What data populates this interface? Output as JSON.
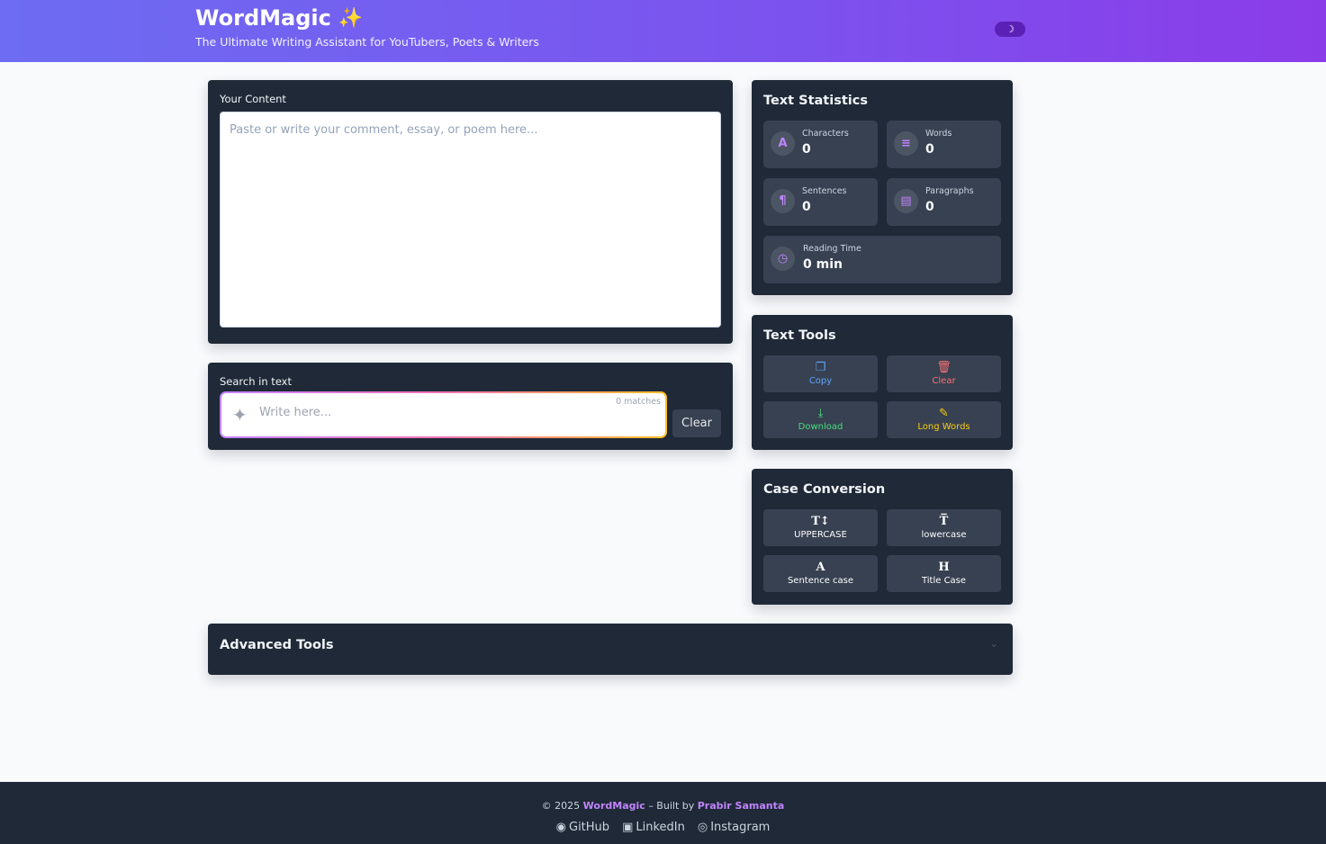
{
  "header": {
    "title": "WordMagic",
    "sparkle": "✨",
    "subtitle": "The Ultimate Writing Assistant for YouTubers, Poets & Writers",
    "theme_icon": "moon-icon"
  },
  "content": {
    "label": "Your Content",
    "placeholder": "Paste or write your comment, essay, or poem here..."
  },
  "search": {
    "label": "Search in text",
    "placeholder": "Write here...",
    "matches": "0 matches",
    "clear_label": "Clear"
  },
  "stats": {
    "title": "Text Statistics",
    "characters": {
      "label": "Characters",
      "value": "0",
      "icon": "A"
    },
    "words": {
      "label": "Words",
      "value": "0",
      "icon": "≡"
    },
    "sentences": {
      "label": "Sentences",
      "value": "0",
      "icon": "¶"
    },
    "paragraphs": {
      "label": "Paragraphs",
      "value": "0",
      "icon": "▤"
    },
    "reading_time": {
      "label": "Reading Time",
      "value": "0 min",
      "icon": "◷"
    }
  },
  "tools": {
    "title": "Text Tools",
    "copy": "Copy",
    "clear": "Clear",
    "download": "Download",
    "long_words": "Long Words"
  },
  "case": {
    "title": "Case Conversion",
    "upper": "UPPERCASE",
    "lower": "lowercase",
    "sentence": "Sentence case",
    "title_case": "Title Case"
  },
  "advanced": {
    "title": "Advanced Tools"
  },
  "footer": {
    "copyright": "© 2025",
    "brand": "WordMagic",
    "built_by": "– Built by",
    "author": "Prabir Samanta",
    "github": "GitHub",
    "linkedin": "LinkedIn",
    "instagram": "Instagram"
  },
  "colors": {
    "header_start": "#6d6cf2",
    "header_end": "#8b3ce9",
    "card_bg": "#1f2937",
    "accent": "#c084fc"
  }
}
